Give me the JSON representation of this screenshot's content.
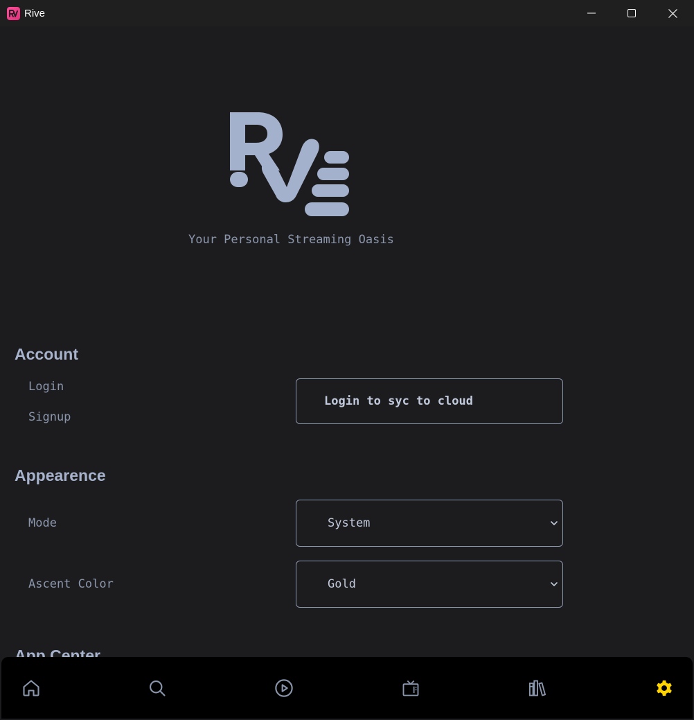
{
  "window": {
    "title": "Rive",
    "app_icon_text": "Rv",
    "minimize_icon": "minimize-icon",
    "maximize_icon": "maximize-icon",
    "close_icon": "close-icon"
  },
  "hero": {
    "logo_text": "Rive",
    "tagline": "Your Personal Streaming Oasis"
  },
  "account": {
    "heading": "Account",
    "login_label": "Login",
    "signup_label": "Signup",
    "cloud_button_label": "Login to syc to cloud"
  },
  "appearence": {
    "heading": "Appearence",
    "mode_label": "Mode",
    "mode_value": "System",
    "ascent_color_label": "Ascent Color",
    "ascent_color_value": "Gold"
  },
  "app_center": {
    "heading": "App Center"
  },
  "bottom_nav": {
    "items": [
      {
        "icon": "home-icon",
        "active": false
      },
      {
        "icon": "search-icon",
        "active": false
      },
      {
        "icon": "play-icon",
        "active": false
      },
      {
        "icon": "tv-icon",
        "active": false
      },
      {
        "icon": "library-icon",
        "active": false
      },
      {
        "icon": "settings-gear-icon",
        "active": true
      }
    ]
  },
  "colors": {
    "background": "#1c1b1d",
    "titlebar": "#1f1f1f",
    "text_muted": "#8b97ad",
    "heading": "#a7b3cc",
    "logo": "#a4b1cc",
    "nav_bar": "#000000",
    "nav_icon": "#8b97ad",
    "accent_gold": "#ffd400",
    "app_icon": "#ff4f9a"
  }
}
